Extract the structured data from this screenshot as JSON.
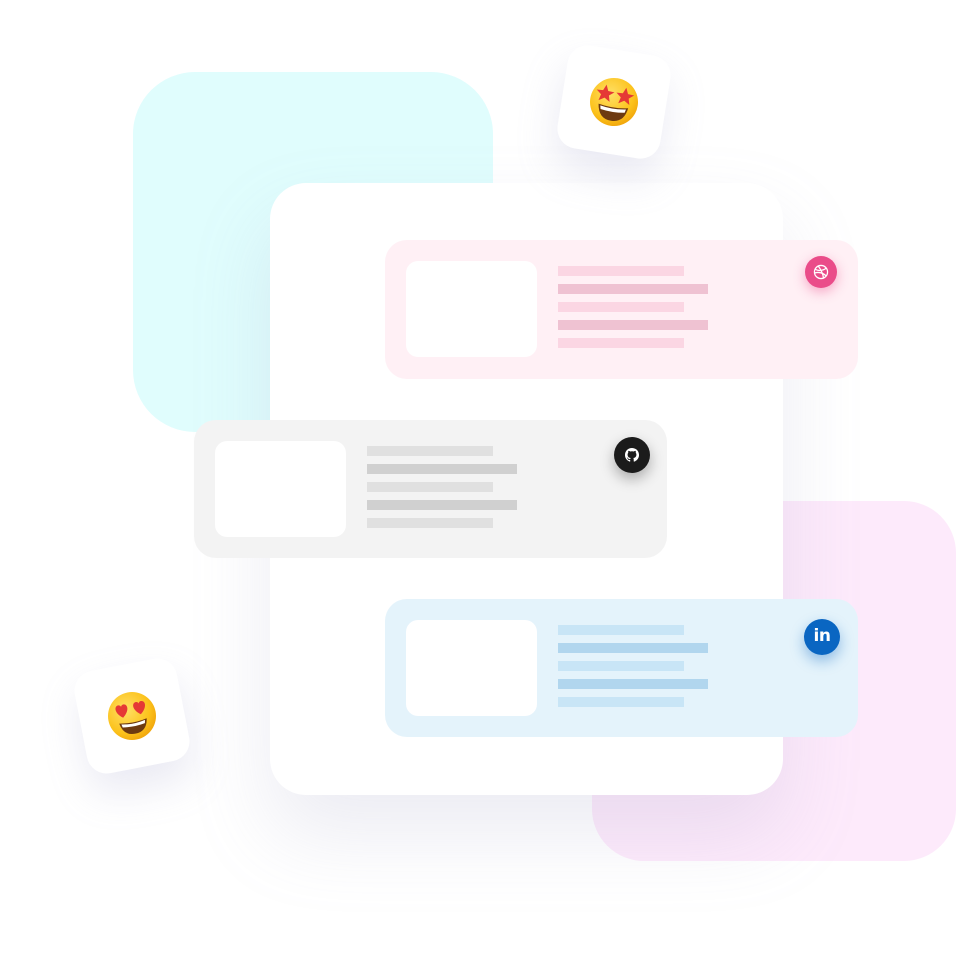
{
  "colors": {
    "cyan_blob": "#e0fdfd",
    "pink_blob": "#fdeafb",
    "dribbble": "#ea4c89",
    "github": "#1b1b1b",
    "linkedin": "#0a66c2"
  },
  "emojis": [
    {
      "name": "star-struck-emoji"
    },
    {
      "name": "heart-eyes-emoji"
    }
  ],
  "cards": [
    {
      "name": "dribbble-card",
      "icon": "dribbble-icon",
      "text_lines": 5
    },
    {
      "name": "github-card",
      "icon": "github-icon",
      "text_lines": 5
    },
    {
      "name": "linkedin-card",
      "icon": "linkedin-icon",
      "label": "in",
      "text_lines": 5
    }
  ]
}
